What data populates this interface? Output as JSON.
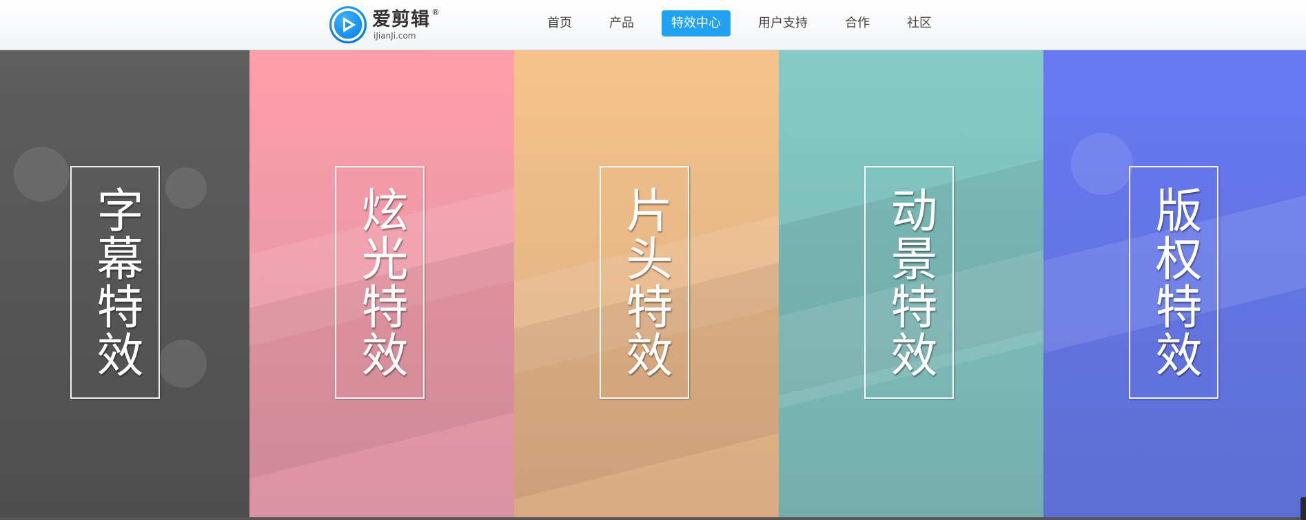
{
  "header": {
    "logo": {
      "cn": "爱剪辑",
      "en": "iJianJi.com",
      "reg": "®",
      "brand_color": "#1b8ff0"
    },
    "nav": [
      {
        "label": "首页",
        "active": false
      },
      {
        "label": "产品",
        "active": false
      },
      {
        "label": "特效中心",
        "active": true
      },
      {
        "label": "用户支持",
        "active": false
      },
      {
        "label": "合作",
        "active": false
      },
      {
        "label": "社区",
        "active": false
      }
    ],
    "nav_active_color": "#1fa3f0"
  },
  "panels": [
    {
      "title": "字幕特效",
      "color_top": "#5e5e5e",
      "color_bottom": "#4e4e4e"
    },
    {
      "title": "炫光特效",
      "color_top": "#ff9ea9",
      "color_bottom": "#d993a4"
    },
    {
      "title": "片头特效",
      "color_top": "#f6c38b",
      "color_bottom": "#d9aa82"
    },
    {
      "title": "动景特效",
      "color_top": "#86cbc8",
      "color_bottom": "#74aeac"
    },
    {
      "title": "版权特效",
      "color_top": "#6979f4",
      "color_bottom": "#5d6fd3"
    }
  ]
}
